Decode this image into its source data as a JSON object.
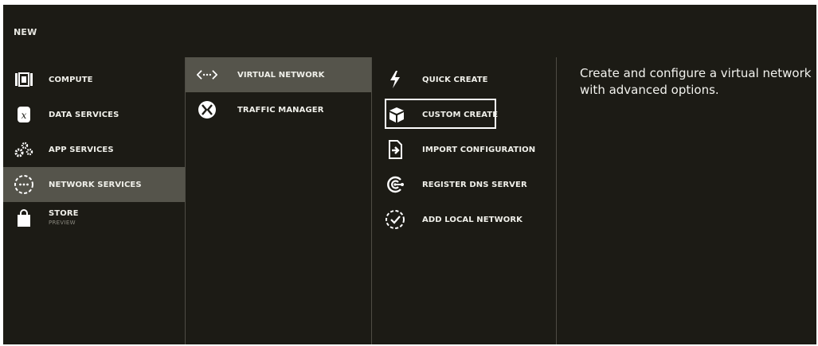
{
  "header": {
    "title": "NEW"
  },
  "categories": [
    {
      "label": "COMPUTE",
      "icon": "compute-icon"
    },
    {
      "label": "DATA SERVICES",
      "icon": "data-services-icon"
    },
    {
      "label": "APP SERVICES",
      "icon": "gears-icon"
    },
    {
      "label": "NETWORK SERVICES",
      "icon": "network-dots-icon",
      "selected": true
    },
    {
      "label": "STORE",
      "sublabel": "PREVIEW",
      "icon": "shopping-bag-icon"
    }
  ],
  "network_services": [
    {
      "label": "VIRTUAL NETWORK",
      "icon": "virtual-network-icon",
      "selected": true
    },
    {
      "label": "TRAFFIC MANAGER",
      "icon": "traffic-manager-icon"
    }
  ],
  "actions": [
    {
      "label": "QUICK CREATE",
      "icon": "lightning-icon"
    },
    {
      "label": "CUSTOM CREATE",
      "icon": "box-icon",
      "focused": true
    },
    {
      "label": "IMPORT CONFIGURATION",
      "icon": "import-icon"
    },
    {
      "label": "REGISTER DNS SERVER",
      "icon": "dns-server-icon"
    },
    {
      "label": "ADD LOCAL NETWORK",
      "icon": "local-network-check-icon"
    }
  ],
  "description": "Create and configure a virtual network with advanced options.",
  "colors": {
    "background": "#1c1b15",
    "selected": "#55544b",
    "divider": "#4e4c44",
    "text": "#ffffff"
  }
}
